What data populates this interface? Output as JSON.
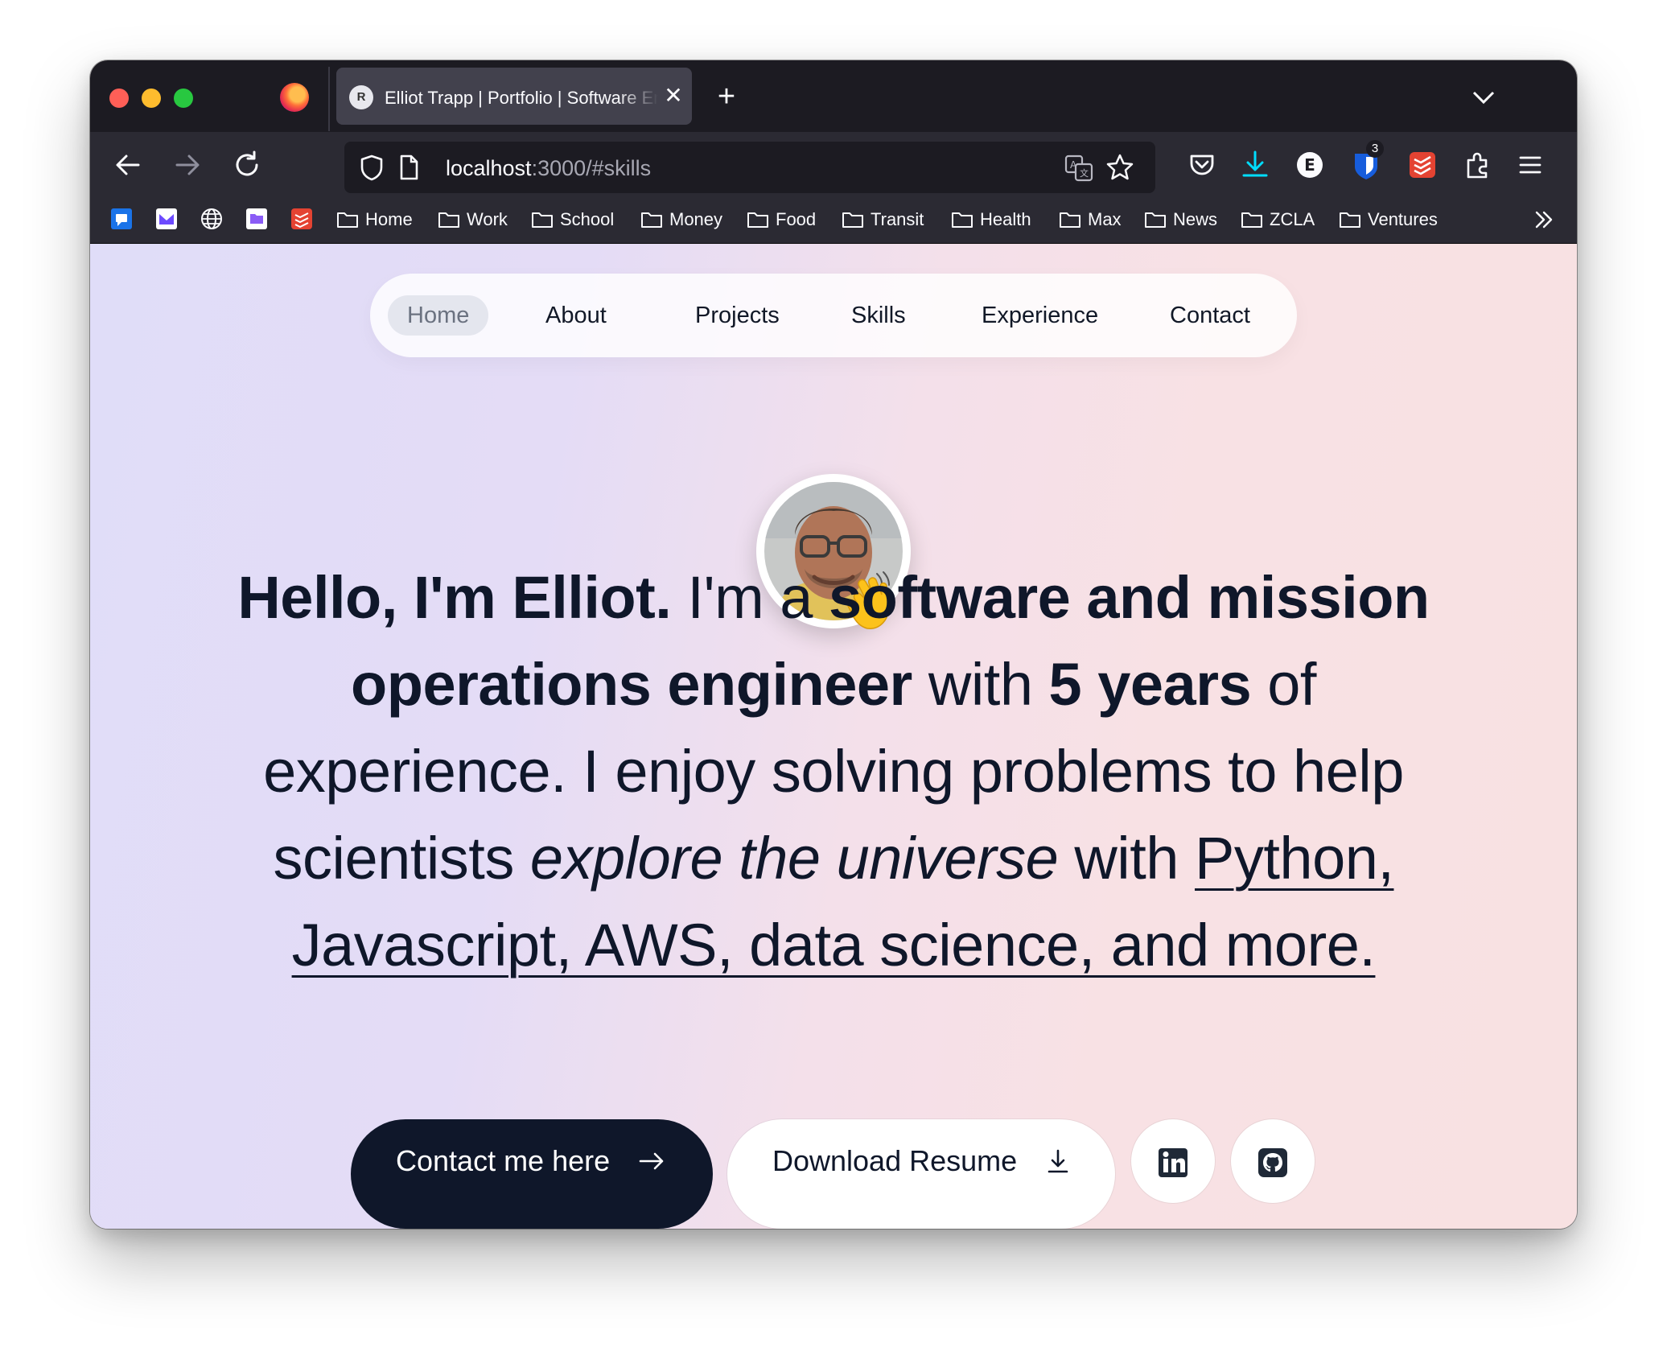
{
  "browser": {
    "tab": {
      "favicon_letter": "R",
      "title": "Elliot Trapp | Portfolio | Software Engineer"
    },
    "url": {
      "host": "localhost",
      "rest": ":3000/#skills"
    },
    "extension_badge": "3",
    "bookmarks": [
      "Home",
      "Work",
      "School",
      "Money",
      "Food",
      "Transit",
      "Health",
      "Max",
      "News",
      "ZCLA",
      "Ventures"
    ]
  },
  "site_nav": {
    "items": [
      "Home",
      "About",
      "Projects",
      "Skills",
      "Experience",
      "Contact"
    ],
    "active": "Home"
  },
  "hero": {
    "p1": "Hello, I'm Elliot.",
    "p2": " I'm a ",
    "p3": "software and mission operations engineer",
    "p4": " with ",
    "p5": "5 years",
    "p6": " of experience. I enjoy solving problems to help scientists ",
    "p7": "explore the universe",
    "p8": " with ",
    "p9": "Python, Javascript, AWS, data science, and more."
  },
  "cta": {
    "contact_label": "Contact me here",
    "resume_label": "Download Resume"
  },
  "colors": {
    "accent_dark": "#0f172a",
    "browser_chrome": "#2b2a33",
    "tab_active": "#42414d",
    "download_icon": "#00ddff"
  }
}
